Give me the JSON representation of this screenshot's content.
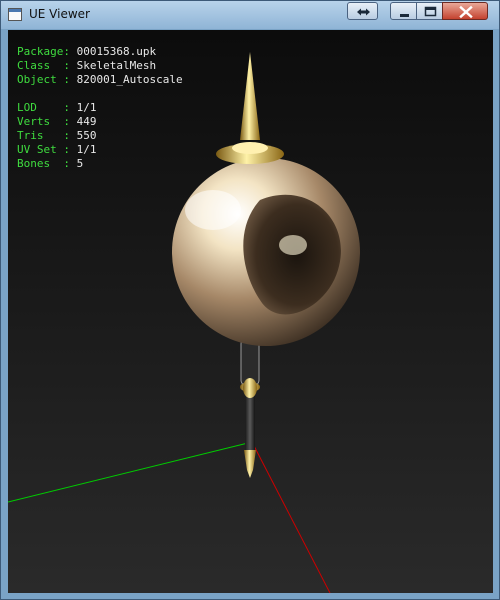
{
  "window": {
    "title": "UE Viewer"
  },
  "titlebar_buttons": {
    "restore_icon": "double-arrow-icon",
    "minimize_icon": "minimize-icon",
    "maximize_icon": "maximize-icon",
    "close_icon": "close-icon"
  },
  "info": {
    "package_label": "Package:",
    "package_value": "00015368.upk",
    "class_label": "Class  :",
    "class_value": "SkeletalMesh",
    "object_label": "Object :",
    "object_value": "820001_Autoscale",
    "lod_label": "LOD    :",
    "lod_value": "1/1",
    "verts_label": "Verts  :",
    "verts_value": "449",
    "tris_label": "Tris   :",
    "tris_value": "550",
    "uvset_label": "UV Set :",
    "uvset_value": "1/1",
    "bones_label": "Bones  :",
    "bones_value": "5"
  },
  "colors": {
    "label_green": "#3fdc3f",
    "value_white": "#e8e8e8",
    "axis_x": "#cc0000",
    "axis_z": "#00cc00"
  }
}
